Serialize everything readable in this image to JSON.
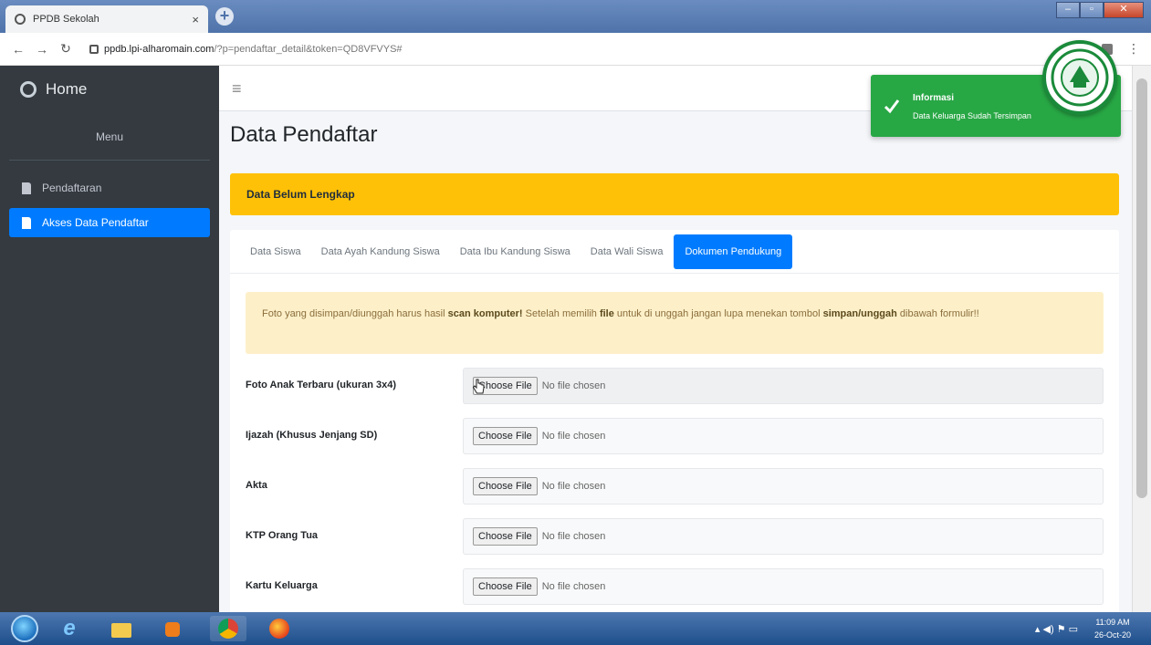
{
  "browser": {
    "tab_title": "PPDB Sekolah",
    "tab_close": "×",
    "new_tab": "+",
    "url_host": "ppdb.lpi-alharomain.com",
    "url_path": "/?p=pendaftar_detail&token=QD8VFVYS#"
  },
  "sidebar": {
    "brand": "Home",
    "menu_title": "Menu",
    "items": [
      {
        "label": "Pendaftaran"
      },
      {
        "label": "Akses Data Pendaftar"
      }
    ]
  },
  "main": {
    "hamburger": "≡",
    "page_title": "Data Pendaftar",
    "status_alert": "Data Belum Lengkap",
    "tabs": [
      {
        "label": "Data Siswa"
      },
      {
        "label": "Data Ayah Kandung Siswa"
      },
      {
        "label": "Data Ibu Kandung Siswa"
      },
      {
        "label": "Data Wali Siswa"
      },
      {
        "label": "Dokumen Pendukung"
      }
    ],
    "info": {
      "part1": "Foto yang disimpan/diunggah harus hasil ",
      "bold1": "scan komputer!",
      "part2": " Setelah memilih ",
      "bold2": "file",
      "part3": " untuk di unggah jangan lupa menekan tombol ",
      "bold3": "simpan/unggah",
      "part4": " dibawah formulir!!"
    },
    "file_fields": [
      {
        "label": "Foto Anak Terbaru (ukuran 3x4)",
        "button": "Choose File",
        "status": "No file chosen"
      },
      {
        "label": "Ijazah (Khusus Jenjang SD)",
        "button": "Choose File",
        "status": "No file chosen"
      },
      {
        "label": "Akta",
        "button": "Choose File",
        "status": "No file chosen"
      },
      {
        "label": "KTP Orang Tua",
        "button": "Choose File",
        "status": "No file chosen"
      },
      {
        "label": "Kartu Keluarga",
        "button": "Choose File",
        "status": "No file chosen"
      }
    ]
  },
  "toast": {
    "title": "Informasi",
    "message": "Data Keluarga Sudah Tersimpan",
    "color": "#28a745"
  },
  "colors": {
    "primary": "#007bff",
    "warning": "#ffc107",
    "sidebar": "#343a40"
  },
  "taskbar": {
    "time": "11:09 AM",
    "date": "26-Oct-20"
  }
}
